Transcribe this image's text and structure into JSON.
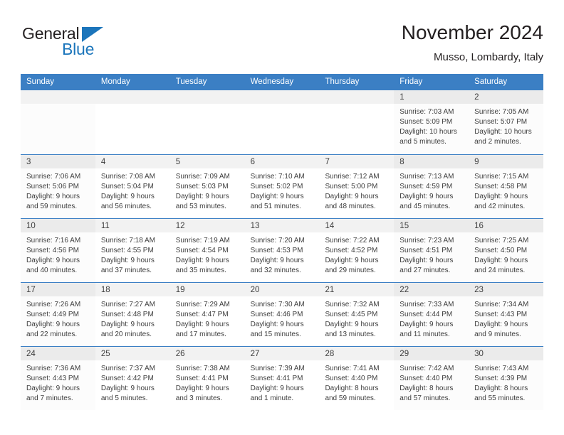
{
  "logo": {
    "word_top": "General",
    "word_bottom": "Blue",
    "accent_color": "#1b75bb"
  },
  "header": {
    "title": "November 2024",
    "subtitle": "Musso, Lombardy, Italy"
  },
  "theme": {
    "header_blue": "#3b7fc4",
    "daynum_gray": "#f2f2f2",
    "weekend_gray": "#ebebeb",
    "text": "#3d3d3d"
  },
  "calendar": {
    "weekdays": [
      "Sunday",
      "Monday",
      "Tuesday",
      "Wednesday",
      "Thursday",
      "Friday",
      "Saturday"
    ],
    "weeks": [
      [
        {
          "day": ""
        },
        {
          "day": ""
        },
        {
          "day": ""
        },
        {
          "day": ""
        },
        {
          "day": ""
        },
        {
          "day": "1",
          "sunrise": "Sunrise: 7:03 AM",
          "sunset": "Sunset: 5:09 PM",
          "daylight1": "Daylight: 10 hours",
          "daylight2": "and 5 minutes."
        },
        {
          "day": "2",
          "sunrise": "Sunrise: 7:05 AM",
          "sunset": "Sunset: 5:07 PM",
          "daylight1": "Daylight: 10 hours",
          "daylight2": "and 2 minutes."
        }
      ],
      [
        {
          "day": "3",
          "sunrise": "Sunrise: 7:06 AM",
          "sunset": "Sunset: 5:06 PM",
          "daylight1": "Daylight: 9 hours",
          "daylight2": "and 59 minutes."
        },
        {
          "day": "4",
          "sunrise": "Sunrise: 7:08 AM",
          "sunset": "Sunset: 5:04 PM",
          "daylight1": "Daylight: 9 hours",
          "daylight2": "and 56 minutes."
        },
        {
          "day": "5",
          "sunrise": "Sunrise: 7:09 AM",
          "sunset": "Sunset: 5:03 PM",
          "daylight1": "Daylight: 9 hours",
          "daylight2": "and 53 minutes."
        },
        {
          "day": "6",
          "sunrise": "Sunrise: 7:10 AM",
          "sunset": "Sunset: 5:02 PM",
          "daylight1": "Daylight: 9 hours",
          "daylight2": "and 51 minutes."
        },
        {
          "day": "7",
          "sunrise": "Sunrise: 7:12 AM",
          "sunset": "Sunset: 5:00 PM",
          "daylight1": "Daylight: 9 hours",
          "daylight2": "and 48 minutes."
        },
        {
          "day": "8",
          "sunrise": "Sunrise: 7:13 AM",
          "sunset": "Sunset: 4:59 PM",
          "daylight1": "Daylight: 9 hours",
          "daylight2": "and 45 minutes."
        },
        {
          "day": "9",
          "sunrise": "Sunrise: 7:15 AM",
          "sunset": "Sunset: 4:58 PM",
          "daylight1": "Daylight: 9 hours",
          "daylight2": "and 42 minutes."
        }
      ],
      [
        {
          "day": "10",
          "sunrise": "Sunrise: 7:16 AM",
          "sunset": "Sunset: 4:56 PM",
          "daylight1": "Daylight: 9 hours",
          "daylight2": "and 40 minutes."
        },
        {
          "day": "11",
          "sunrise": "Sunrise: 7:18 AM",
          "sunset": "Sunset: 4:55 PM",
          "daylight1": "Daylight: 9 hours",
          "daylight2": "and 37 minutes."
        },
        {
          "day": "12",
          "sunrise": "Sunrise: 7:19 AM",
          "sunset": "Sunset: 4:54 PM",
          "daylight1": "Daylight: 9 hours",
          "daylight2": "and 35 minutes."
        },
        {
          "day": "13",
          "sunrise": "Sunrise: 7:20 AM",
          "sunset": "Sunset: 4:53 PM",
          "daylight1": "Daylight: 9 hours",
          "daylight2": "and 32 minutes."
        },
        {
          "day": "14",
          "sunrise": "Sunrise: 7:22 AM",
          "sunset": "Sunset: 4:52 PM",
          "daylight1": "Daylight: 9 hours",
          "daylight2": "and 29 minutes."
        },
        {
          "day": "15",
          "sunrise": "Sunrise: 7:23 AM",
          "sunset": "Sunset: 4:51 PM",
          "daylight1": "Daylight: 9 hours",
          "daylight2": "and 27 minutes."
        },
        {
          "day": "16",
          "sunrise": "Sunrise: 7:25 AM",
          "sunset": "Sunset: 4:50 PM",
          "daylight1": "Daylight: 9 hours",
          "daylight2": "and 24 minutes."
        }
      ],
      [
        {
          "day": "17",
          "sunrise": "Sunrise: 7:26 AM",
          "sunset": "Sunset: 4:49 PM",
          "daylight1": "Daylight: 9 hours",
          "daylight2": "and 22 minutes."
        },
        {
          "day": "18",
          "sunrise": "Sunrise: 7:27 AM",
          "sunset": "Sunset: 4:48 PM",
          "daylight1": "Daylight: 9 hours",
          "daylight2": "and 20 minutes."
        },
        {
          "day": "19",
          "sunrise": "Sunrise: 7:29 AM",
          "sunset": "Sunset: 4:47 PM",
          "daylight1": "Daylight: 9 hours",
          "daylight2": "and 17 minutes."
        },
        {
          "day": "20",
          "sunrise": "Sunrise: 7:30 AM",
          "sunset": "Sunset: 4:46 PM",
          "daylight1": "Daylight: 9 hours",
          "daylight2": "and 15 minutes."
        },
        {
          "day": "21",
          "sunrise": "Sunrise: 7:32 AM",
          "sunset": "Sunset: 4:45 PM",
          "daylight1": "Daylight: 9 hours",
          "daylight2": "and 13 minutes."
        },
        {
          "day": "22",
          "sunrise": "Sunrise: 7:33 AM",
          "sunset": "Sunset: 4:44 PM",
          "daylight1": "Daylight: 9 hours",
          "daylight2": "and 11 minutes."
        },
        {
          "day": "23",
          "sunrise": "Sunrise: 7:34 AM",
          "sunset": "Sunset: 4:43 PM",
          "daylight1": "Daylight: 9 hours",
          "daylight2": "and 9 minutes."
        }
      ],
      [
        {
          "day": "24",
          "sunrise": "Sunrise: 7:36 AM",
          "sunset": "Sunset: 4:43 PM",
          "daylight1": "Daylight: 9 hours",
          "daylight2": "and 7 minutes."
        },
        {
          "day": "25",
          "sunrise": "Sunrise: 7:37 AM",
          "sunset": "Sunset: 4:42 PM",
          "daylight1": "Daylight: 9 hours",
          "daylight2": "and 5 minutes."
        },
        {
          "day": "26",
          "sunrise": "Sunrise: 7:38 AM",
          "sunset": "Sunset: 4:41 PM",
          "daylight1": "Daylight: 9 hours",
          "daylight2": "and 3 minutes."
        },
        {
          "day": "27",
          "sunrise": "Sunrise: 7:39 AM",
          "sunset": "Sunset: 4:41 PM",
          "daylight1": "Daylight: 9 hours",
          "daylight2": "and 1 minute."
        },
        {
          "day": "28",
          "sunrise": "Sunrise: 7:41 AM",
          "sunset": "Sunset: 4:40 PM",
          "daylight1": "Daylight: 8 hours",
          "daylight2": "and 59 minutes."
        },
        {
          "day": "29",
          "sunrise": "Sunrise: 7:42 AM",
          "sunset": "Sunset: 4:40 PM",
          "daylight1": "Daylight: 8 hours",
          "daylight2": "and 57 minutes."
        },
        {
          "day": "30",
          "sunrise": "Sunrise: 7:43 AM",
          "sunset": "Sunset: 4:39 PM",
          "daylight1": "Daylight: 8 hours",
          "daylight2": "and 55 minutes."
        }
      ]
    ]
  }
}
